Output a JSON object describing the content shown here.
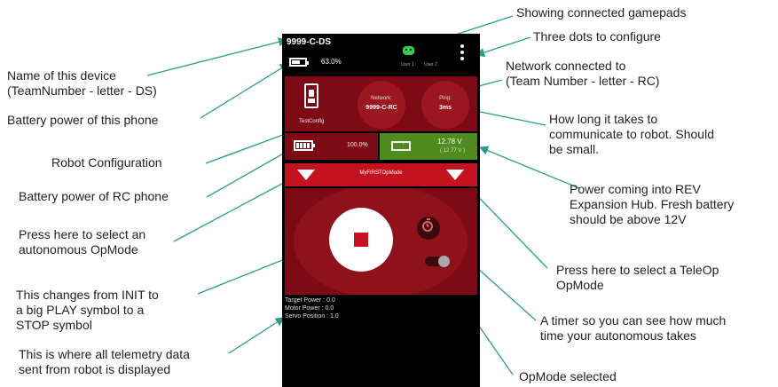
{
  "phone": {
    "device_name": "9999-C-DS",
    "battery_pct": "63.0%",
    "gamepads": [
      "User 1",
      "User 2"
    ],
    "config_name": "TestConfig",
    "network_label": "Network:",
    "network_value": "9999-C-RC",
    "ping_label": "Ping:",
    "ping_value": "3ms",
    "rc_battery_pct": "100.0%",
    "hub_voltage": "12.78 V",
    "hub_voltage_sub": "( 12.77 V )",
    "opmode_selected": "MyFIRSTOpMode",
    "telemetry": [
      "Target Power : 0.0",
      "Motor Power : 0.0",
      "Servo Position : 1.0"
    ]
  },
  "annotations": {
    "gamepads": "Showing connected gamepads",
    "three_dots": "Three dots to configure",
    "device_name": [
      "Name of this device",
      "(TeamNumber - letter - DS)"
    ],
    "network": [
      "Network connected to",
      "(Team Number - letter - RC)"
    ],
    "phone_battery": "Battery power of this phone",
    "ping": [
      "How long it takes to",
      "communicate to robot.  Should",
      "be small."
    ],
    "robot_config": "Robot Configuration",
    "rc_battery": "Battery power of RC phone",
    "hub_power": [
      "Power coming into REV",
      "Expansion Hub.   Fresh battery",
      "should be above 12V"
    ],
    "auto_opmode": [
      "Press here to select an",
      "autonomous OpMode"
    ],
    "teleop_opmode": [
      "Press here to select a TeleOp",
      "OpMode"
    ],
    "init_play_stop": [
      "This changes from INIT to",
      "a big PLAY symbol to a",
      "STOP symbol"
    ],
    "timer": [
      "A timer so you can see how much",
      "time your autonomous takes"
    ],
    "telemetry": [
      "This is where all telemetry data",
      "sent from robot is displayed"
    ],
    "opmode_selected": "OpMode selected"
  },
  "colors": {
    "dark_red": "#7d0a14",
    "bright_red": "#c5121f",
    "green": "#4f8b1d",
    "arrow": "#2a9d8f"
  }
}
